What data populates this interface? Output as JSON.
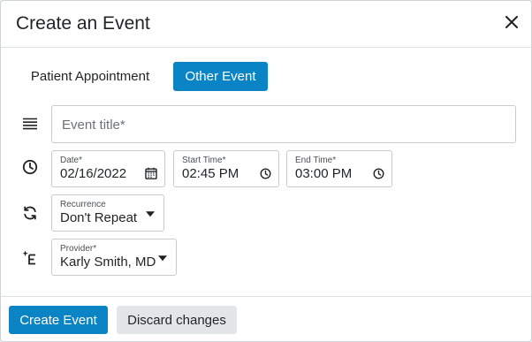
{
  "dialog": {
    "title": "Create an Event",
    "close_icon": "close-icon"
  },
  "tabs": [
    {
      "label": "Patient Appointment",
      "selected": false
    },
    {
      "label": "Other Event",
      "selected": true
    }
  ],
  "title_field": {
    "placeholder": "Event title*",
    "value": ""
  },
  "date": {
    "label": "Date*",
    "value": "02/16/2022",
    "icon": "calendar-icon"
  },
  "start_time": {
    "label": "Start Time*",
    "value": "02:45 PM",
    "icon": "clock-icon"
  },
  "end_time": {
    "label": "End Time*",
    "value": "03:00 PM",
    "icon": "clock-icon"
  },
  "recurrence": {
    "label": "Recurrence",
    "value": "Don't Repeat"
  },
  "provider": {
    "label": "Provider*",
    "value": "Karly Smith, MD"
  },
  "row_icons": [
    "menu-lines-icon",
    "clock-icon",
    "refresh-icon",
    "provider-icon"
  ],
  "footer": {
    "create_label": "Create Event",
    "discard_label": "Discard changes"
  },
  "colors": {
    "accent": "#0b84c6",
    "secondary_button": "#e3e6e9"
  }
}
